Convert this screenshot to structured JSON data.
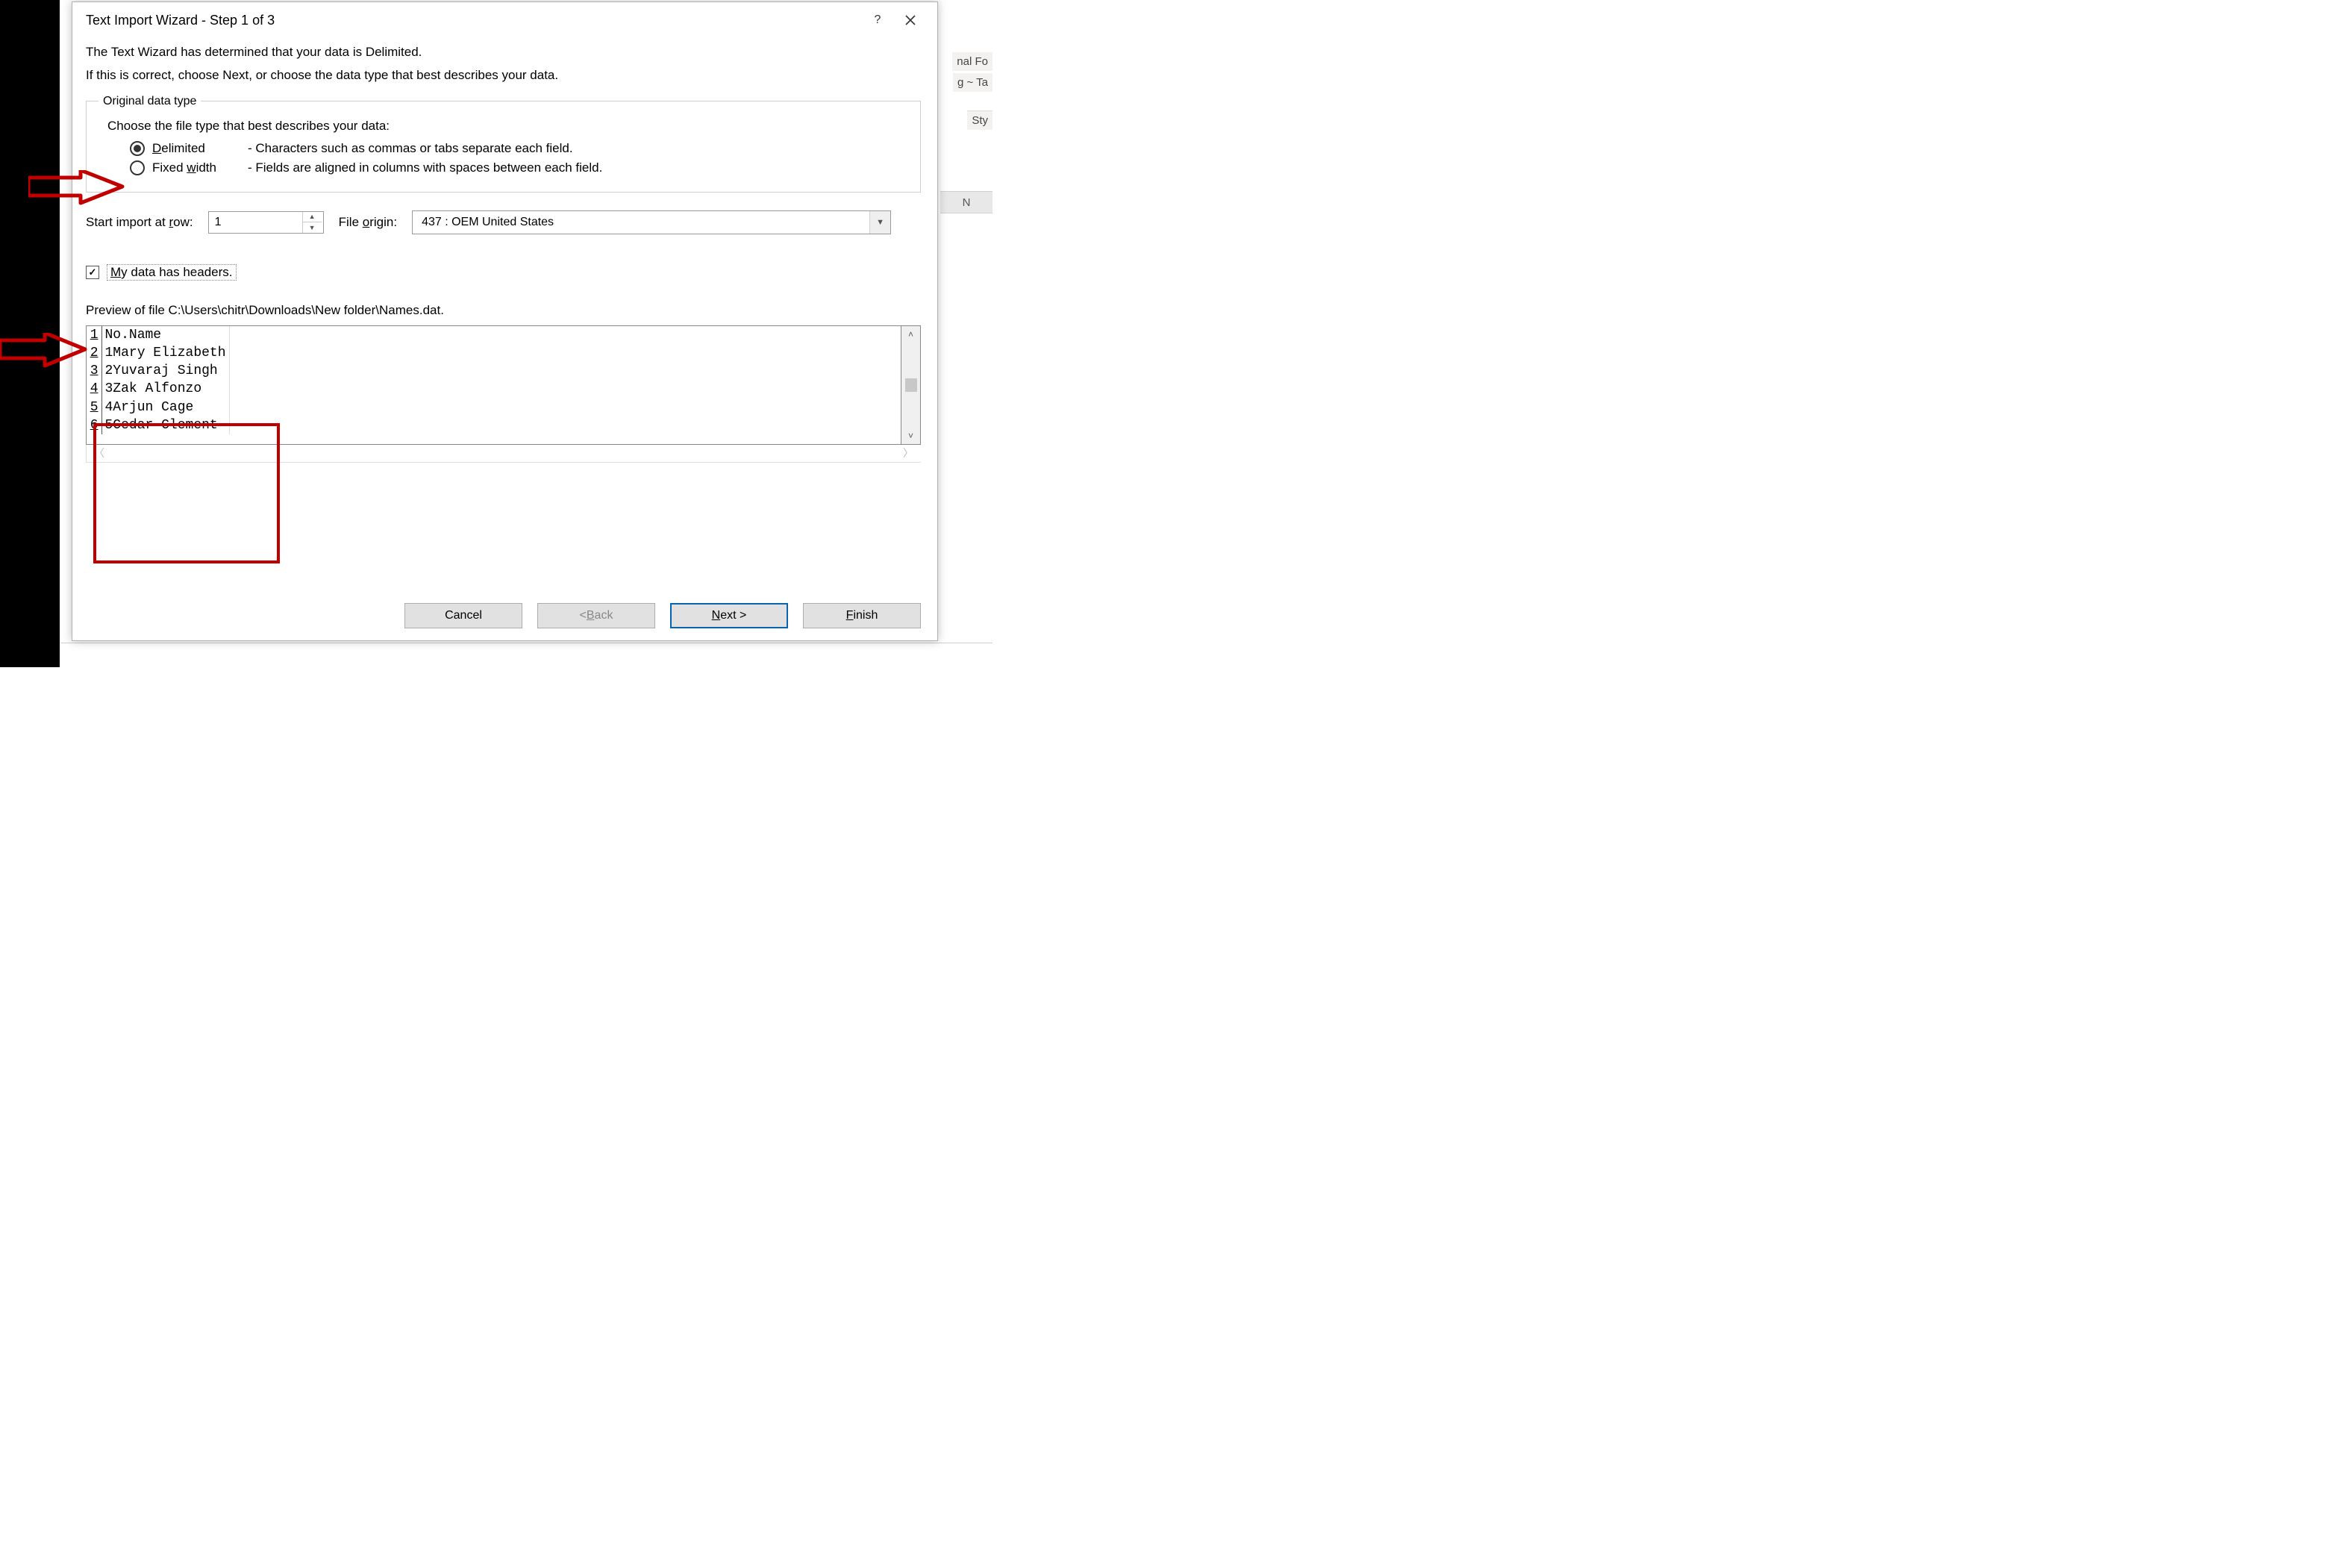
{
  "dialog": {
    "title": "Text Import Wizard - Step 1 of 3",
    "intro1": "The Text Wizard has determined that your data is Delimited.",
    "intro2": "If this is correct, choose Next, or choose the data type that best describes your data.",
    "group_legend": "Original data type",
    "choose_line": "Choose the file type that best describes your data:",
    "radio_delimited": "Delimited",
    "radio_delimited_desc": "- Characters such as commas or tabs separate each field.",
    "radio_fixed": "Fixed width",
    "radio_fixed_desc": "- Fields are aligned in columns with spaces between each field.",
    "delimited_selected": true,
    "start_row_label": "Start import at row:",
    "start_row_value": "1",
    "file_origin_label": "File origin:",
    "file_origin_value": "437 : OEM United States",
    "headers_checked": true,
    "headers_label": "My data has headers.",
    "preview_label": "Preview of file C:\\Users\\chitr\\Downloads\\New folder\\Names.dat.",
    "preview_rows": [
      {
        "n": "1",
        "text": "No.Name"
      },
      {
        "n": "2",
        "text": "1Mary Elizabeth"
      },
      {
        "n": "3",
        "text": "2Yuvaraj Singh"
      },
      {
        "n": "4",
        "text": "3Zak Alfonzo"
      },
      {
        "n": "5",
        "text": "4Arjun Cage"
      },
      {
        "n": "6",
        "text": "5Cedar Clement"
      }
    ],
    "buttons": {
      "cancel": "Cancel",
      "back": "< Back",
      "next": "Next >",
      "finish": "Finish"
    }
  },
  "background": {
    "ribbon_frag_top1": "nal  Fo",
    "ribbon_frag_top2": "g ~   Ta",
    "ribbon_frag_styles": "Sty",
    "col_header": "N"
  },
  "annotations": {
    "desc": "Two red arrows point to the Delimited radio and the headers checkbox; a red rectangle highlights the preview list."
  }
}
